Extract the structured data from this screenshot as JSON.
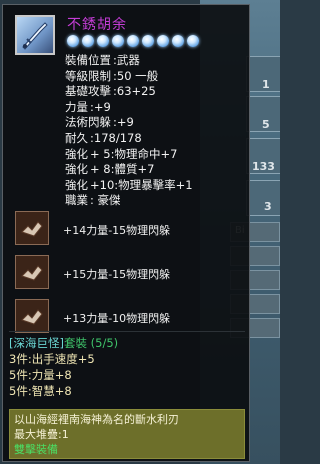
{
  "item": {
    "title": "不銹胡余",
    "star_count": 9,
    "stats": [
      {
        "key": "裝備位置",
        "value": ":武器"
      },
      {
        "key": "等級限制",
        "value": ":50 一般"
      },
      {
        "key": "基礎攻擊",
        "value": ":63+25"
      },
      {
        "key": "力量",
        "value": ":+9"
      },
      {
        "key": "法術閃躲",
        "value": ":+9"
      },
      {
        "key": "耐久",
        "value": ":178/178"
      },
      {
        "key": "強化",
        "value": "+ 5:物理命中+7"
      },
      {
        "key": "強化",
        "value": "+ 8:體質+7"
      },
      {
        "key": "強化",
        "value": "+10:物理暴擊率+1"
      },
      {
        "key": "職業",
        "value": ": 豪傑"
      }
    ],
    "runes": [
      {
        "text": "+14力量-15物理閃躲",
        "icon": "rune-icon"
      },
      {
        "text": "+15力量-15物理閃躲",
        "icon": "rune-icon"
      },
      {
        "text": "+13力量-10物理閃躲",
        "icon": "rune-icon"
      }
    ],
    "set": {
      "name_prefix": "[深海巨怪]",
      "name_suffix": "套裝 (5/5)",
      "bonuses": [
        "3件:出手速度+5",
        "5件:力量+8",
        "5件:智慧+8"
      ]
    },
    "description": {
      "line1": "以山海經裡南海神為名的斷水利刃",
      "line2": "最大堆疊:1",
      "line3": "雙擊裝備"
    }
  },
  "background": {
    "numbers": [
      "1",
      "5",
      "133",
      "3"
    ],
    "bar_label": "Bi"
  },
  "colors": {
    "title": "#c43dd6",
    "set_name": "#3fc36a",
    "set_bonus": "#f0e6b4",
    "desc_bg": "#6d6f2a",
    "desc_action": "#4bdd64"
  }
}
